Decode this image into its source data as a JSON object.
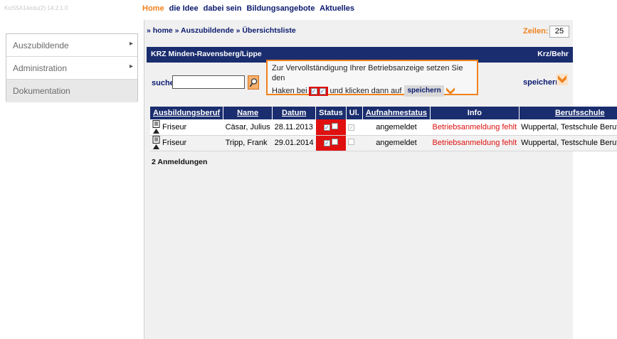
{
  "app": {
    "version": "Krz55A14edu(2) 14.2.1.0"
  },
  "topnav": [
    {
      "label": "Home",
      "active": true
    },
    {
      "label": "die Idee",
      "active": false
    },
    {
      "label": "dabei sein",
      "active": false
    },
    {
      "label": "Bildungsangebote",
      "active": false
    },
    {
      "label": "Aktuelles",
      "active": false
    }
  ],
  "sidebar": {
    "items": [
      {
        "label": "Auszubildende"
      },
      {
        "label": "Administration"
      },
      {
        "label": "Dokumentation"
      }
    ]
  },
  "breadcrumb": "» home » Auszubildende » Übersichtsliste",
  "zeilen": {
    "label": "Zeilen:",
    "value": "25"
  },
  "orgbar": {
    "left": "KRZ Minden-Ravensberg/Lippe",
    "right": "Krz/Behr"
  },
  "search": {
    "label": "suche",
    "value": ""
  },
  "notice": {
    "line1": "Zur Vervollständigung Ihrer Betriebsanzeige setzen Sie den",
    "line2_pre": "Haken bei",
    "line2_mid": "und klicken dann auf",
    "button": "speichern"
  },
  "save": {
    "label": "speichern"
  },
  "table": {
    "headers": [
      "Ausbildungsberuf",
      "Name",
      "Datum",
      "Status",
      "Ul.",
      "Aufnahmestatus",
      "Info",
      "Berufsschule"
    ],
    "rows": [
      {
        "beruf": "Friseur",
        "name": "Cäsar, Julius",
        "datum": "28.11.2013",
        "aufnahme": "angemeldet",
        "info": "Betriebsanmeldung fehlt",
        "schule": "Wuppertal, Testschule Berufskolle"
      },
      {
        "beruf": "Friseur",
        "name": "Tripp, Frank",
        "datum": "29.01.2014",
        "aufnahme": "angemeldet",
        "info": "Betriebsanmeldung fehlt",
        "schule": "Wuppertal, Testschule Berufskolle"
      }
    ]
  },
  "count_text": "2 Anmeldungen",
  "colors": {
    "accent": "#f0821e",
    "navy": "#1a2d6e",
    "alert": "#e01010"
  }
}
